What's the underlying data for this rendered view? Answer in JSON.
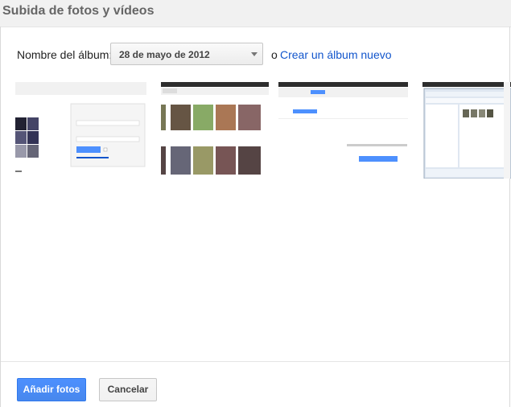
{
  "dialog": {
    "title": "Subida de fotos y vídeos"
  },
  "album": {
    "label": "Nombre del álbum:",
    "selected": "28 de mayo de 2012",
    "or_text": "o",
    "create_link": "Crear un álbum nuevo"
  },
  "thumbnails": [
    {
      "name": "screenshot-login-page"
    },
    {
      "name": "screenshot-picasa-album"
    },
    {
      "name": "screenshot-upload-page"
    },
    {
      "name": "screenshot-file-dialog"
    }
  ],
  "footer": {
    "add_button": "Añadir fotos",
    "cancel_button": "Cancelar"
  },
  "colors": {
    "primary_blue": "#4d90fe",
    "link_blue": "#1155cc",
    "title_gray": "#666666"
  }
}
